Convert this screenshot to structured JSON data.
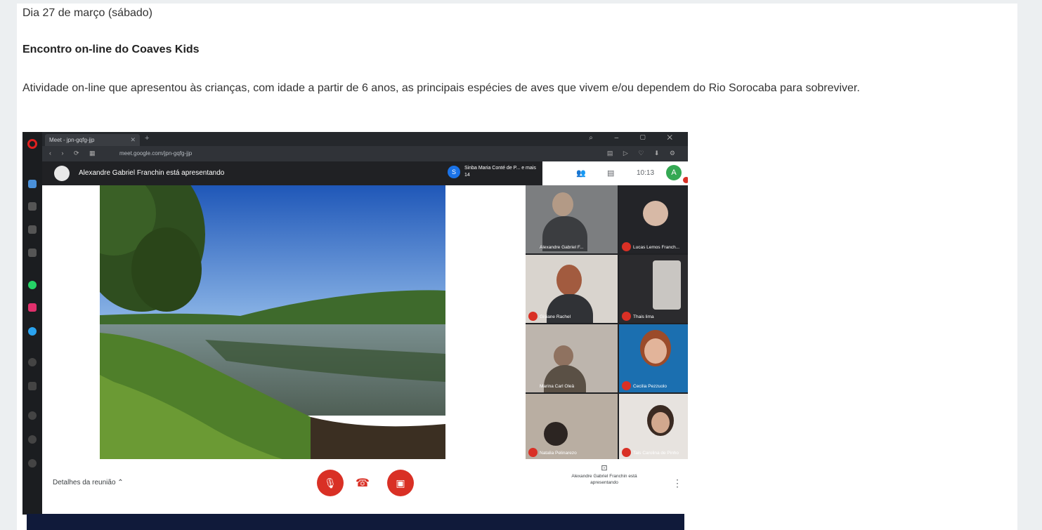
{
  "post": {
    "date": "Dia 27 de março (sábado)",
    "title": "Encontro on-line do Coaves Kids",
    "description": "Atividade on-line que apresentou às crianças, com idade a partir de 6 anos, as principais espécies de aves que vivem e/ou dependem do Rio Sorocaba para sobreviver."
  },
  "browser": {
    "tab_title": "Meet - jpn-gqfg-jjp",
    "url": "meet.google.com/jpn-gqfg-jjp"
  },
  "meet": {
    "presenter_text": "Alexandre Gabriel Franchin está apresentando",
    "pinned_badge": "S",
    "pinned_text": "Sinba Maria Conté de P... e mais 14",
    "time": "10:13",
    "self_avatar": "A",
    "participants": [
      {
        "name": "Alexandre Gabriel F..."
      },
      {
        "name": "Lucas Lemos Franch..."
      },
      {
        "name": "Gisiane Rachel"
      },
      {
        "name": "Thais lima"
      },
      {
        "name": "Marina Carl Oleä"
      },
      {
        "name": "Cecilia Pezzuolo"
      },
      {
        "name": "Natalia Pelinarezo"
      },
      {
        "name": "Tais Carolina de Pinho"
      }
    ],
    "details_label": "Detalhes da reunião",
    "presenting_label": "Alexandre Gabriel Franchin está apresentando"
  },
  "colors": {
    "meet_red": "#d93025",
    "meet_dark": "#202124",
    "google_green": "#34a853",
    "google_blue": "#1a73e8"
  },
  "icons": {
    "mic_off": "mic-off-icon",
    "hangup": "call-end-icon",
    "cam_off": "videocam-off-icon",
    "present": "present-screen-icon"
  }
}
